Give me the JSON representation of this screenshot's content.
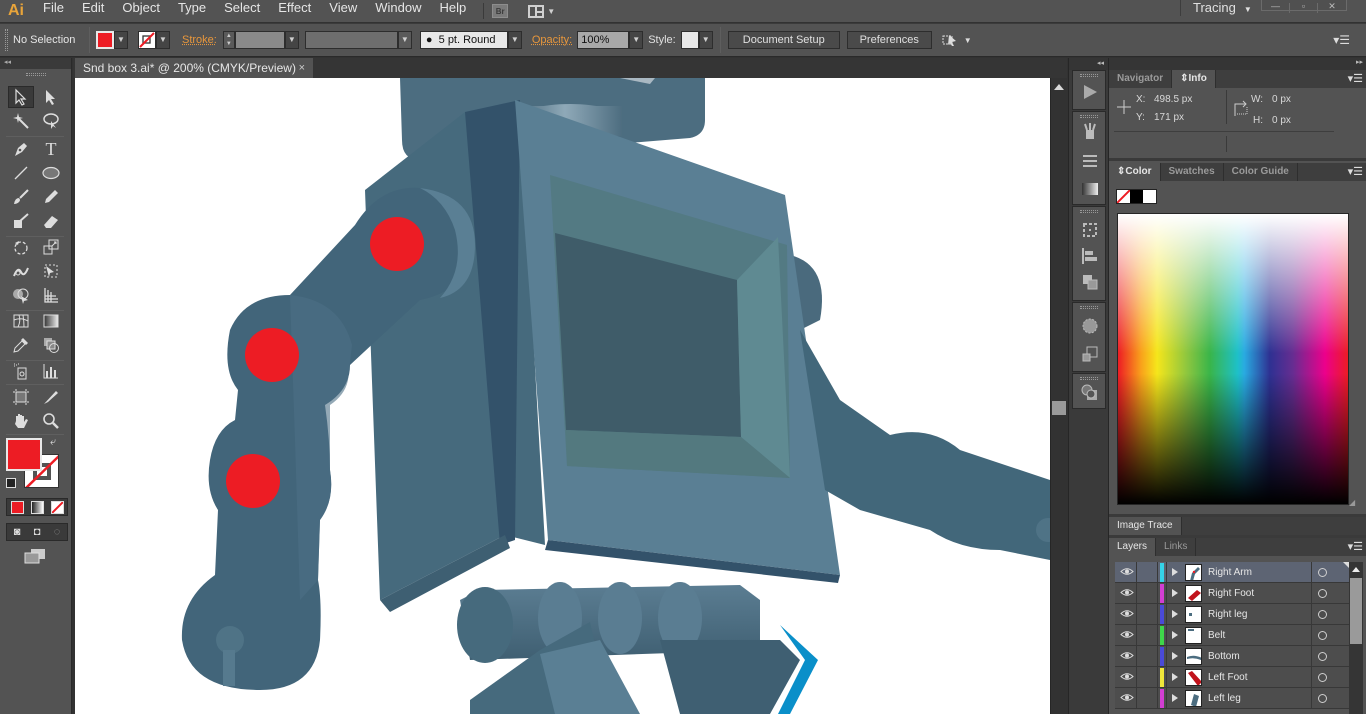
{
  "app": {
    "logo": "Ai",
    "menu": [
      "File",
      "Edit",
      "Object",
      "Type",
      "Select",
      "Effect",
      "View",
      "Window",
      "Help"
    ],
    "bridge_label": "Br",
    "workspace": "Tracing"
  },
  "control_bar": {
    "selection_status": "No Selection",
    "fill_color": "#ed1c24",
    "stroke_label": "Stroke:",
    "brush_value": "5 pt. Round",
    "opacity_label": "Opacity:",
    "opacity_value": "100%",
    "style_label": "Style:",
    "document_setup_label": "Document Setup",
    "preferences_label": "Preferences"
  },
  "document": {
    "tab_title": "Snd box 3.ai* @ 200% (CMYK/Preview)",
    "close_glyph": "×"
  },
  "tools": {
    "fill_color": "#ed1c24",
    "stroke": "none"
  },
  "info_panel": {
    "tabs": [
      "Navigator",
      "Info"
    ],
    "active_tab": "Info",
    "x_label": "X:",
    "x_value": "498.5 px",
    "y_label": "Y:",
    "y_value": "171 px",
    "w_label": "W:",
    "w_value": "0 px",
    "h_label": "H:",
    "h_value": "0 px"
  },
  "color_panel": {
    "tabs": [
      "Color",
      "Swatches",
      "Color Guide"
    ],
    "active_tab": "Color"
  },
  "image_trace_panel": {
    "title": "Image Trace"
  },
  "layers_panel": {
    "tabs": [
      "Layers",
      "Links"
    ],
    "active_tab": "Layers",
    "layers": [
      {
        "name": "Right Arm",
        "color": "#35d3e8",
        "selected": true
      },
      {
        "name": "Right Foot",
        "color": "#d23ed2",
        "selected": false
      },
      {
        "name": "Right leg",
        "color": "#4a4ad8",
        "selected": false
      },
      {
        "name": "Belt",
        "color": "#3ed64a",
        "selected": false
      },
      {
        "name": "Bottom",
        "color": "#4a4ad8",
        "selected": false
      },
      {
        "name": "Left Foot",
        "color": "#f0e63a",
        "selected": false
      },
      {
        "name": "Left leg",
        "color": "#d23ed2",
        "selected": false
      }
    ]
  }
}
